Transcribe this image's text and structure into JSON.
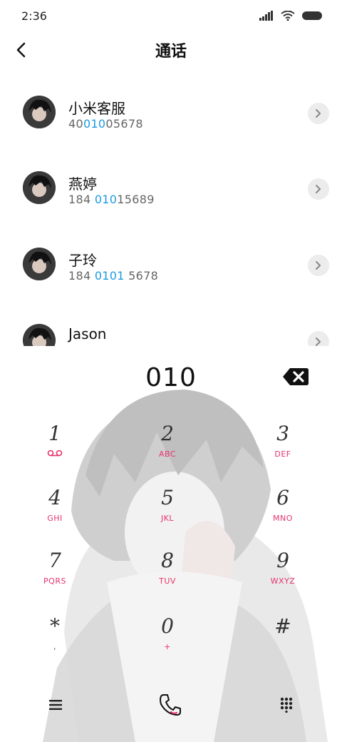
{
  "status_bar": {
    "time": "2:36"
  },
  "header": {
    "title": "通话"
  },
  "contacts": [
    {
      "name": "小米客服",
      "number_parts": [
        "40",
        "010",
        "05678"
      ]
    },
    {
      "name": "燕婷",
      "number_parts": [
        "184 ",
        "010",
        "15689"
      ]
    },
    {
      "name": "子玲",
      "number_parts": [
        "184 ",
        "0101",
        " 5678"
      ]
    },
    {
      "name": "Jason",
      "number_parts": [
        "",
        "",
        ""
      ]
    }
  ],
  "dialer": {
    "input_value": "010",
    "keys": [
      {
        "digit": "1",
        "letters": ""
      },
      {
        "digit": "2",
        "letters": "ABC"
      },
      {
        "digit": "3",
        "letters": "DEF"
      },
      {
        "digit": "4",
        "letters": "GHI"
      },
      {
        "digit": "5",
        "letters": "JKL"
      },
      {
        "digit": "6",
        "letters": "MNO"
      },
      {
        "digit": "7",
        "letters": "PQRS"
      },
      {
        "digit": "8",
        "letters": "TUV"
      },
      {
        "digit": "9",
        "letters": "WXYZ"
      },
      {
        "digit": "*",
        "letters": ","
      },
      {
        "digit": "0",
        "letters": "+"
      },
      {
        "digit": "#",
        "letters": ""
      }
    ]
  },
  "icons": {
    "back": "back-arrow-icon",
    "chevron": "chevron-right-icon",
    "backspace": "backspace-icon",
    "voicemail": "voicemail-icon",
    "menu": "menu-icon",
    "call": "phone-icon",
    "keypad_toggle": "dialpad-icon"
  },
  "colors": {
    "highlight": "#1a9be0",
    "key_letters": "#e8336d"
  }
}
